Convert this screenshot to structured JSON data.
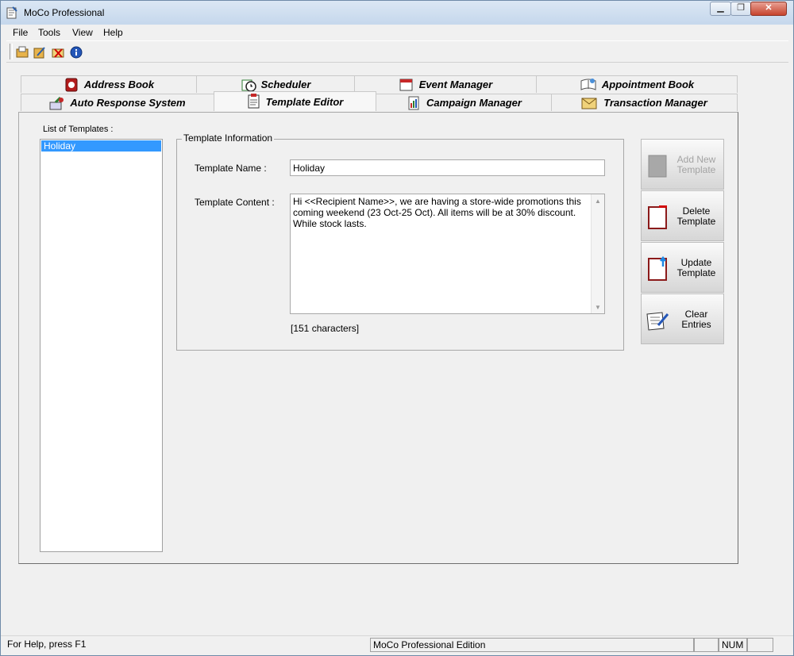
{
  "window": {
    "title": "MoCo Professional"
  },
  "menu": [
    "File",
    "Tools",
    "View",
    "Help"
  ],
  "toolbar": [
    "open-book-icon",
    "edit-book-icon",
    "delete-mail-icon",
    "info-icon"
  ],
  "tabs_back": [
    {
      "label": "Address Book",
      "icon": "address-book-icon"
    },
    {
      "label": "Scheduler",
      "icon": "scheduler-icon"
    },
    {
      "label": "Event Manager",
      "icon": "event-manager-icon"
    },
    {
      "label": "Appointment Book",
      "icon": "appointment-book-icon"
    }
  ],
  "tabs_front": [
    {
      "label": "Auto Response System",
      "icon": "auto-response-icon"
    },
    {
      "label": "Template Editor",
      "icon": "template-editor-icon",
      "active": true
    },
    {
      "label": "Campaign Manager",
      "icon": "campaign-manager-icon"
    },
    {
      "label": "Transaction Manager",
      "icon": "transaction-manager-icon"
    }
  ],
  "templates": {
    "list_label": "List of Templates :",
    "items": [
      "Holiday"
    ],
    "selected": "Holiday"
  },
  "template_info": {
    "group_title": "Template Information",
    "name_label": "Template Name :",
    "name_value": "Holiday",
    "content_label": "Template Content :",
    "content_value": "Hi <<Recipient Name>>, we are having a store-wide promotions this coming weekend (23 Oct-25 Oct). All items will be at 30% discount. While stock lasts.",
    "char_count": "[151 characters]"
  },
  "actions": {
    "add_new": "Add New\nTemplate",
    "delete": "Delete\nTemplate",
    "update": "Update\nTemplate",
    "clear": "Clear\nEntries"
  },
  "status": {
    "help": "For Help, press F1",
    "edition": "MoCo Professional Edition",
    "num": "NUM"
  }
}
